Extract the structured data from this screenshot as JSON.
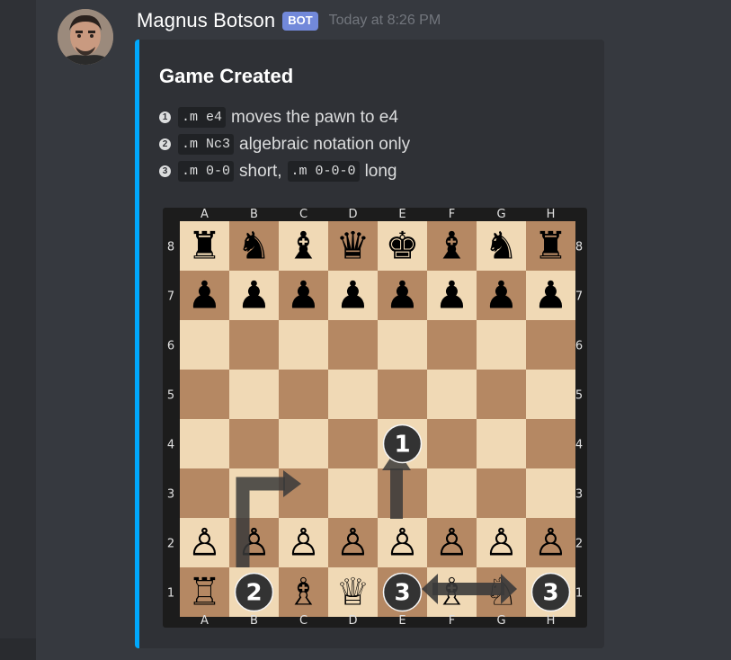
{
  "message": {
    "username": "Magnus Botson",
    "badge": "BOT",
    "timestamp": "Today at 8:26 PM"
  },
  "embed": {
    "accent_color": "#00a8fc",
    "title": "Game Created",
    "instructions": [
      {
        "num": "1",
        "parts": [
          {
            "code": ".m e4"
          },
          {
            "text": "moves the pawn to e4"
          }
        ]
      },
      {
        "num": "2",
        "parts": [
          {
            "code": ".m Nc3"
          },
          {
            "text": "algebraic notation only"
          }
        ]
      },
      {
        "num": "3",
        "parts": [
          {
            "code": ".m 0-0"
          },
          {
            "text": "short,"
          },
          {
            "code": ".m 0-0-0"
          },
          {
            "text": "long"
          }
        ]
      }
    ]
  },
  "board": {
    "light_color": "#f0d9b5",
    "dark_color": "#b58863",
    "files": [
      "A",
      "B",
      "C",
      "D",
      "E",
      "F",
      "G",
      "H"
    ],
    "ranks": [
      "8",
      "7",
      "6",
      "5",
      "4",
      "3",
      "2",
      "1"
    ],
    "position": [
      [
        "♜",
        "♞",
        "♝",
        "♛",
        "♚",
        "♝",
        "♞",
        "♜"
      ],
      [
        "♟",
        "♟",
        "♟",
        "♟",
        "♟",
        "♟",
        "♟",
        "♟"
      ],
      [
        "",
        "",
        "",
        "",
        "",
        "",
        "",
        ""
      ],
      [
        "",
        "",
        "",
        "",
        "",
        "",
        "",
        ""
      ],
      [
        "",
        "",
        "",
        "",
        "",
        "",
        "",
        ""
      ],
      [
        "",
        "",
        "",
        "",
        "",
        "",
        "",
        ""
      ],
      [
        "♙",
        "♙",
        "♙",
        "♙",
        "♙",
        "♙",
        "♙",
        "♙"
      ],
      [
        "♖",
        "",
        "♗",
        "♕",
        "",
        "♗",
        "♘",
        ""
      ]
    ],
    "markers": [
      {
        "label": "1",
        "square": "e4"
      },
      {
        "label": "2",
        "square": "b1"
      },
      {
        "label": "3",
        "square": "e1"
      },
      {
        "label": "3",
        "square": "h1"
      }
    ]
  }
}
